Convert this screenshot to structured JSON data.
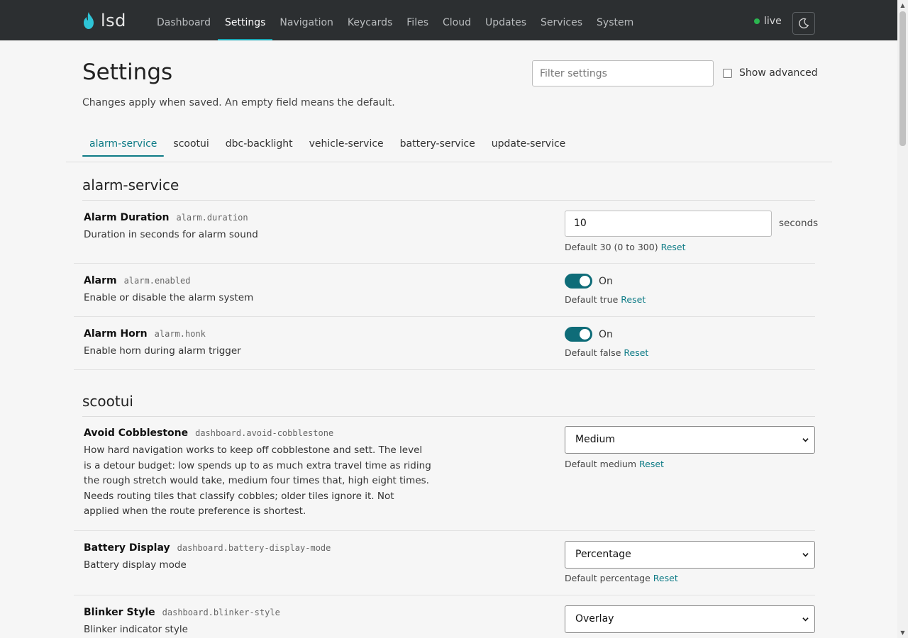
{
  "app": {
    "brand": "lsd",
    "live_label": "live"
  },
  "nav": [
    {
      "label": "Dashboard",
      "active": false
    },
    {
      "label": "Settings",
      "active": true
    },
    {
      "label": "Navigation",
      "active": false
    },
    {
      "label": "Keycards",
      "active": false
    },
    {
      "label": "Files",
      "active": false
    },
    {
      "label": "Cloud",
      "active": false
    },
    {
      "label": "Updates",
      "active": false
    },
    {
      "label": "Services",
      "active": false
    },
    {
      "label": "System",
      "active": false
    }
  ],
  "header": {
    "title": "Settings",
    "subtitle": "Changes apply when saved. An empty field means the default.",
    "filter_placeholder": "Filter settings",
    "show_advanced_label": "Show advanced",
    "show_advanced_checked": false
  },
  "tabs": [
    "alarm-service",
    "scootui",
    "dbc-backlight",
    "vehicle-service",
    "battery-service",
    "update-service"
  ],
  "active_tab": "alarm-service",
  "sections": {
    "alarm_service": {
      "title": "alarm-service",
      "duration": {
        "name": "Alarm Duration",
        "key": "alarm.duration",
        "desc": "Duration in seconds for alarm sound",
        "value": "10",
        "unit": "seconds",
        "default_text": "Default 30 (0 to 300)",
        "reset": "Reset"
      },
      "enabled": {
        "name": "Alarm",
        "key": "alarm.enabled",
        "desc": "Enable or disable the alarm system",
        "state_label": "On",
        "default_text": "Default true",
        "reset": "Reset"
      },
      "honk": {
        "name": "Alarm Horn",
        "key": "alarm.honk",
        "desc": "Enable horn during alarm trigger",
        "state_label": "On",
        "default_text": "Default false",
        "reset": "Reset"
      }
    },
    "scootui": {
      "title": "scootui",
      "cobblestone": {
        "name": "Avoid Cobblestone",
        "key": "dashboard.avoid-cobblestone",
        "desc": "How hard navigation works to keep off cobblestone and sett. The level is a detour budget: low spends up to as much extra travel time as riding the rough stretch would take, medium four times that, high eight times. Needs routing tiles that classify cobbles; older tiles ignore it. Not applied when the route preference is shortest.",
        "selected": "Medium",
        "default_text": "Default medium",
        "reset": "Reset"
      },
      "battery_display": {
        "name": "Battery Display",
        "key": "dashboard.battery-display-mode",
        "desc": "Battery display mode",
        "selected": "Percentage",
        "default_text": "Default percentage",
        "reset": "Reset"
      },
      "blinker": {
        "name": "Blinker Style",
        "key": "dashboard.blinker-style",
        "desc": "Blinker indicator style",
        "selected": "Overlay"
      }
    }
  }
}
